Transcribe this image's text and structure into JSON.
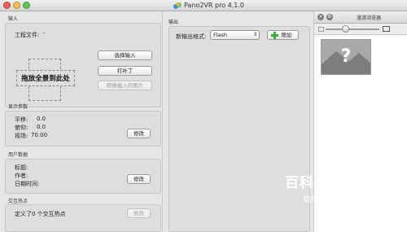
{
  "window": {
    "title": "Pano2VR pro 4.1.0"
  },
  "input_section": {
    "label": "输入",
    "project_file_label": "工程文件:",
    "project_file_value": "-",
    "dropzone_label": "拖放全景到此处",
    "select_input_button": "选择输入",
    "patch_button": "打补丁",
    "convert_button": "转换输入的图片"
  },
  "display_params": {
    "label": "显示参数",
    "pan_label": "平移:",
    "pan_value": "0.0",
    "tilt_label": "俯仰:",
    "tilt_value": "0.0",
    "fov_label": "视场:",
    "fov_value": "70.00",
    "modify_button": "修改"
  },
  "user_data": {
    "label": "用户数据",
    "title_label": "标题:",
    "author_label": "作者:",
    "datetime_label": "日期时间:",
    "modify_button": "修改"
  },
  "hotspots": {
    "label": "交互热点",
    "summary": "定义了0 个交互热点",
    "modify_button": "修改"
  },
  "output": {
    "label": "输出",
    "new_format_label": "新输出格式:",
    "format_selected": "Flash",
    "add_button": "增加"
  },
  "browser": {
    "title": "漫游浏览器",
    "thumb_placeholder": "?"
  },
  "watermark": {
    "logo": "百科全说",
    "sub": "助你轻松解决"
  },
  "colors": {
    "add_icon": "#3cae3c",
    "accent_white": "#ffffff"
  }
}
